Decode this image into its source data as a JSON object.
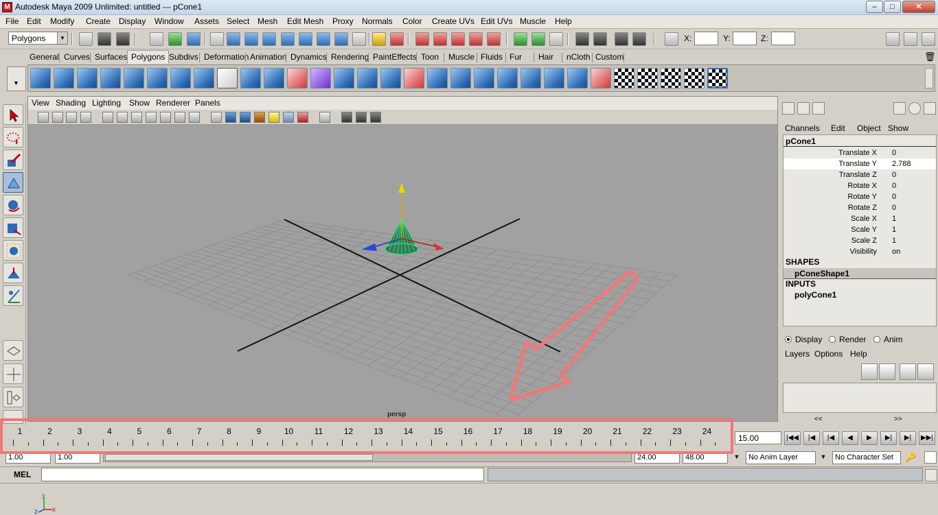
{
  "window": {
    "title": "Autodesk Maya 2009 Unlimited: untitled   ---   pCone1"
  },
  "menubar": [
    "File",
    "Edit",
    "Modify",
    "Create",
    "Display",
    "Window",
    "Assets",
    "Select",
    "Mesh",
    "Edit Mesh",
    "Proxy",
    "Normals",
    "Color",
    "Create UVs",
    "Edit UVs",
    "Muscle",
    "Help"
  ],
  "status": {
    "module": "Polygons",
    "x_label": "X:",
    "y_label": "Y:",
    "z_label": "Z:"
  },
  "shelf_tabs": [
    "General",
    "Curves",
    "Surfaces",
    "Polygons",
    "Subdivs",
    "Deformation",
    "Animation",
    "Dynamics",
    "Rendering",
    "PaintEffects",
    "Toon",
    "Muscle",
    "Fluids",
    "Fur",
    "Hair",
    "nCloth",
    "Custom"
  ],
  "active_shelf": "Polygons",
  "viewport": {
    "menu": [
      "View",
      "Shading",
      "Lighting",
      "Show",
      "Renderer",
      "Panels"
    ],
    "camera_label": "persp",
    "axis": {
      "x": "x",
      "y": "y",
      "z": "z"
    }
  },
  "channel_box": {
    "menu": [
      "Channels",
      "Edit",
      "Object",
      "Show"
    ],
    "object": "pCone1",
    "attributes": [
      {
        "name": "Translate X",
        "value": "0"
      },
      {
        "name": "Translate Y",
        "value": "2.788"
      },
      {
        "name": "Translate Z",
        "value": "0"
      },
      {
        "name": "Rotate X",
        "value": "0"
      },
      {
        "name": "Rotate Y",
        "value": "0"
      },
      {
        "name": "Rotate Z",
        "value": "0"
      },
      {
        "name": "Scale X",
        "value": "1"
      },
      {
        "name": "Scale Y",
        "value": "1"
      },
      {
        "name": "Scale Z",
        "value": "1"
      },
      {
        "name": "Visibility",
        "value": "on"
      }
    ],
    "shapes_label": "SHAPES",
    "shape": "pConeShape1",
    "inputs_label": "INPUTS",
    "input": "polyCone1"
  },
  "layer_editor": {
    "modes": [
      "Display",
      "Render",
      "Anim"
    ],
    "selected_mode": "Display",
    "menu": [
      "Layers",
      "Options",
      "Help"
    ],
    "arrows": [
      "<<",
      ">>"
    ]
  },
  "timeline": {
    "frames": [
      "1",
      "2",
      "3",
      "4",
      "5",
      "6",
      "7",
      "8",
      "9",
      "10",
      "11",
      "12",
      "13",
      "14",
      "15",
      "16",
      "17",
      "18",
      "19",
      "20",
      "21",
      "22",
      "23",
      "24"
    ],
    "current_frame": "15.00"
  },
  "range": {
    "start": "1.00",
    "playback_start": "1.00",
    "playback_end": "24.00",
    "end": "48.00",
    "anim_layer": "No Anim Layer",
    "character_set": "No Character Set"
  },
  "command_line": {
    "label": "MEL"
  },
  "colors": {
    "highlight": "#f07878",
    "grid": "#8c8c8c",
    "cone": "#4ee08a"
  }
}
